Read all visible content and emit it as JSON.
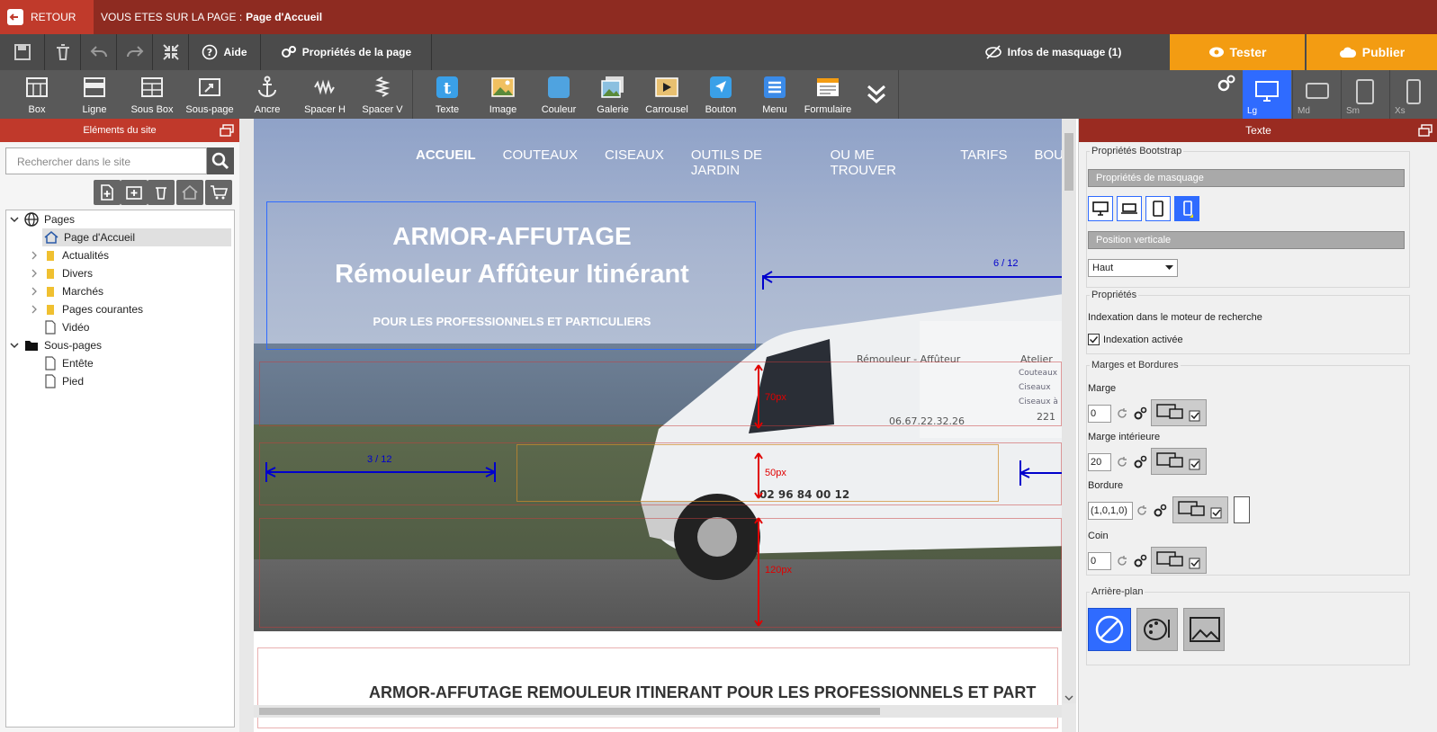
{
  "topbar": {
    "back_label": "RETOUR",
    "page_prefix": "VOUS ETES SUR LA PAGE :",
    "page_name": "Page d'Accueil"
  },
  "toolbar1": {
    "help": "Aide",
    "page_props": "Propriétés de la page",
    "masking_info": "Infos de masquage (1)",
    "test": "Tester",
    "publish": "Publier"
  },
  "toolbar2": {
    "tools": [
      "Box",
      "Ligne",
      "Sous Box",
      "Sous-page",
      "Ancre",
      "Spacer H",
      "Spacer V",
      "Texte",
      "Image",
      "Couleur",
      "Galerie",
      "Carrousel",
      "Bouton",
      "Menu",
      "Formulaire"
    ],
    "devices": [
      "Lg",
      "Md",
      "Sm",
      "Xs"
    ]
  },
  "left": {
    "title": "Eléments du site",
    "search_placeholder": "Rechercher dans le site",
    "tree": {
      "pages": "Pages",
      "home": "Page d'Accueil",
      "actualites": "Actualités",
      "divers": "Divers",
      "marches": "Marchés",
      "pages_courantes": "Pages courantes",
      "video": "Vidéo",
      "sous_pages": "Sous-pages",
      "entete": "Entête",
      "pied": "Pied"
    }
  },
  "canvas": {
    "nav": [
      "ACCUEIL",
      "COUTEAUX",
      "CISEAUX",
      "OUTILS DE JARDIN",
      "OU ME TROUVER",
      "TARIFS",
      "BOU"
    ],
    "hero_title1": "ARMOR-AFFUTAGE",
    "hero_title2": "Rémouleur Affûteur Itinérant",
    "hero_sub": "POUR LES PROFESSIONNELS ET PARTICULIERS",
    "col_label_left": "3 / 12",
    "col_label_right": "6 / 12",
    "spacer1": "70px",
    "spacer2": "50px",
    "spacer3": "120px",
    "van_text1": "Rémouleur - Affûteur",
    "van_text2": "Atelier",
    "van_list": [
      "Couteaux",
      "Ciseaux",
      "Ciseaux à"
    ],
    "van_phone1": "06.67.22.32.26",
    "van_phone2": "02 96 84 00 12",
    "van_num": "221",
    "below_title": "ARMOR-AFFUTAGE REMOULEUR ITINERANT POUR LES PROFESSIONNELS ET PART"
  },
  "right": {
    "title": "Texte",
    "bootstrap": "Propriétés Bootstrap",
    "masking_props": "Propriétés de masquage",
    "vertical_pos": "Position verticale",
    "vertical_value": "Haut",
    "props": "Propriétés",
    "indexing": "Indexation dans le moteur de recherche",
    "indexing_checkbox": "Indexation activée",
    "margins_borders": "Marges et Bordures",
    "margin": "Marge",
    "margin_value": "0",
    "padding": "Marge intérieure",
    "padding_value": "20",
    "border": "Bordure",
    "border_value": "(1,0,1,0)",
    "corner": "Coin",
    "corner_value": "0",
    "background": "Arrière-plan"
  },
  "colors": {
    "topbar": "#8e2b21",
    "accent_red": "#c0392b",
    "orange": "#f39c12",
    "toolbar": "#4b4b4b",
    "selection_blue": "#2f6bff"
  }
}
